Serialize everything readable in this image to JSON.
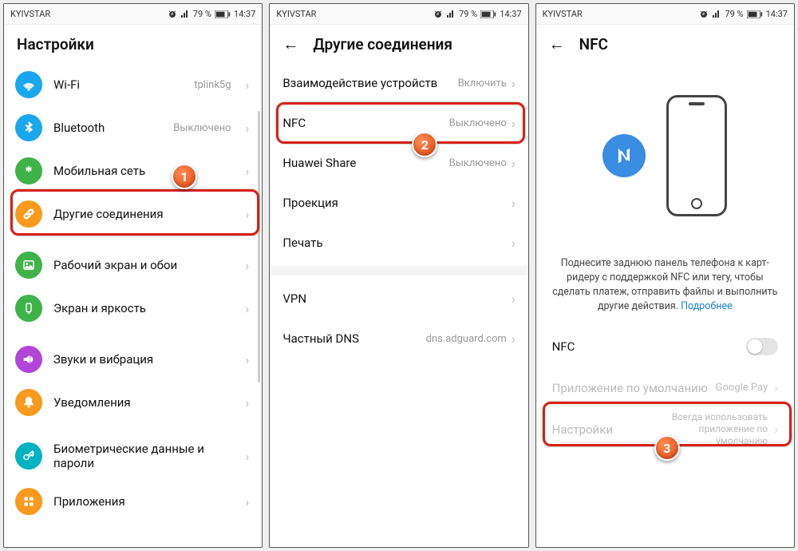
{
  "status": {
    "carrier": "KYIVSTAR",
    "battery": "79 %",
    "time": "14:37"
  },
  "screen1": {
    "title": "Настройки",
    "items": [
      {
        "label": "Wi-Fi",
        "value": "tplink5g",
        "color": "#1aa7ee",
        "icon": "wifi"
      },
      {
        "label": "Bluetooth",
        "value": "Выключено",
        "color": "#1aa7ee",
        "icon": "bluetooth"
      },
      {
        "label": "Мобильная сеть",
        "value": "",
        "color": "#3fb24a",
        "icon": "signal"
      },
      {
        "label": "Другие соединения",
        "value": "",
        "color": "#f79a1e",
        "icon": "link"
      },
      {
        "label": "Рабочий экран и обои",
        "value": "",
        "color": "#3fb24a",
        "icon": "image"
      },
      {
        "label": "Экран и яркость",
        "value": "",
        "color": "#3fb24a",
        "icon": "brightness"
      },
      {
        "label": "Звуки и вибрация",
        "value": "",
        "color": "#b246d8",
        "icon": "sound"
      },
      {
        "label": "Уведомления",
        "value": "",
        "color": "#f79a1e",
        "icon": "bell"
      },
      {
        "label": "Биометрические данные и пароли",
        "value": "",
        "color": "#00b3c0",
        "icon": "key"
      },
      {
        "label": "Приложения",
        "value": "",
        "color": "#f79a1e",
        "icon": "apps"
      }
    ]
  },
  "screen2": {
    "title": "Другие соединения",
    "items_a": [
      {
        "label": "Взаимодействие устройств",
        "value": "Включить"
      },
      {
        "label": "NFC",
        "value": "Выключено"
      },
      {
        "label": "Huawei Share",
        "value": "Выключено"
      },
      {
        "label": "Проекция",
        "value": ""
      },
      {
        "label": "Печать",
        "value": ""
      }
    ],
    "items_b": [
      {
        "label": "VPN",
        "value": ""
      },
      {
        "label": "Частный DNS",
        "value": "dns.adguard.com"
      }
    ]
  },
  "screen3": {
    "title": "NFC",
    "desc": "Поднесите заднюю панель телефона к карт-ридеру с поддержкой NFC или тегу, чтобы сделать платеж, отправить файлы и выполнить другие действия.",
    "more": "Подробнее",
    "rows": {
      "nfc_label": "NFC",
      "default_app_label": "Приложение по умолчанию",
      "default_app_value": "Google Pay",
      "settings_label": "Настройки",
      "settings_value": "Всегда использовать приложение по умолчанию"
    }
  },
  "markers": {
    "one": "1",
    "two": "2",
    "three": "3"
  }
}
